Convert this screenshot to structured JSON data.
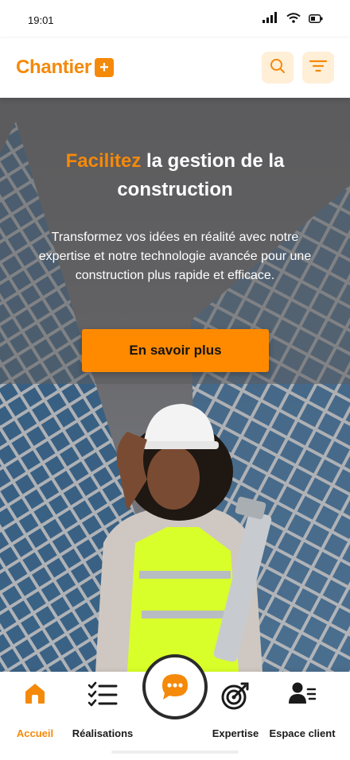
{
  "status": {
    "time": "19:01",
    "icons": [
      "signal-icon",
      "wifi-icon",
      "battery-icon"
    ]
  },
  "brand": {
    "name": "Chantier",
    "badge": "+"
  },
  "header": {
    "search_icon": "search-icon",
    "filter_icon": "filter-icon"
  },
  "hero": {
    "title_accent": "Facilitez",
    "title_rest": " la gestion de la construction",
    "subtitle": "Transformez vos idées en réalité avec notre expertise et notre technologie avancée pour une construction plus rapide et efficace.",
    "cta": "En savoir plus"
  },
  "nav": {
    "items": [
      {
        "label": "Accueil",
        "icon": "home-icon",
        "active": true
      },
      {
        "label": "Réalisations",
        "icon": "checklist-icon",
        "active": false
      },
      {
        "label": "Expertise",
        "icon": "target-icon",
        "active": false
      },
      {
        "label": "Espace client",
        "icon": "user-list-icon",
        "active": false
      }
    ],
    "chat_icon": "chat-icon"
  },
  "colors": {
    "accent": "#F5890A",
    "accent_light": "#FFEFD7",
    "cta": "#FF8A00"
  }
}
